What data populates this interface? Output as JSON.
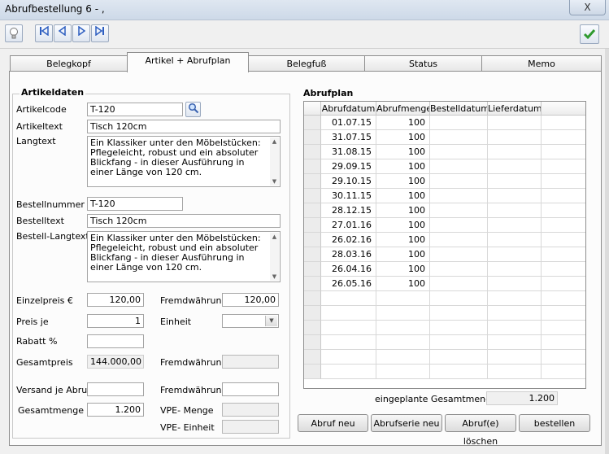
{
  "window": {
    "title": "Abrufbestellung 6 -  ,",
    "close_label": "X"
  },
  "toolbar": {
    "hint_icon": "lightbulb-icon",
    "confirm_icon": "checkmark-icon"
  },
  "tabs": [
    {
      "label": "Belegkopf",
      "active": false
    },
    {
      "label": "Artikel + Abrufplan",
      "active": true
    },
    {
      "label": "Belegfuß",
      "active": false
    },
    {
      "label": "Status",
      "active": false
    },
    {
      "label": "Memo",
      "active": false
    }
  ],
  "artikel": {
    "section_title": "Artikeldaten",
    "artikelcode_label": "Artikelcode",
    "artikelcode": "T-120",
    "artikeltext_label": "Artikeltext",
    "artikeltext": "Tisch 120cm",
    "langtext_label": "Langtext",
    "langtext": "Ein Klassiker unter den Möbelstücken: Pflegeleicht, robust und ein absoluter Blickfang - in dieser Ausführung in einer Länge von 120 cm.",
    "bestellnummer_label": "Bestellnummer",
    "bestellnummer": "T-120",
    "bestelltext_label": "Bestelltext",
    "bestelltext": "Tisch 120cm",
    "bestell_langtext_label": "Bestell-Langtext",
    "bestell_langtext": "Ein Klassiker unter den Möbelstücken: Pflegeleicht, robust und ein absoluter Blickfang - in dieser Ausführung in einer Länge von 120 cm.",
    "einzelpreis_label": "Einzelpreis €",
    "einzelpreis": "120,00",
    "fremdwaehrung1_label": "Fremdwährung",
    "fremdwaehrung1": "120,00",
    "preis_je_label": "Preis je",
    "preis_je": "1",
    "einheit_label": "Einheit",
    "einheit": "",
    "rabatt_label": "Rabatt %",
    "rabatt": "",
    "gesamtpreis_label": "Gesamtpreis",
    "gesamtpreis": "144.000,00",
    "fremdwaehrung2_label": "Fremdwährung",
    "fremdwaehrung2": "",
    "versand_label": "Versand je Abruf",
    "versand": "",
    "fremdwaehrung3_label": "Fremdwährung",
    "fremdwaehrung3": "",
    "gesamtmenge_label": "Gesamtmenge",
    "gesamtmenge": "1.200",
    "vpe_menge_label": "VPE- Menge",
    "vpe_menge": "",
    "vpe_einheit_label": "VPE- Einheit",
    "vpe_einheit": ""
  },
  "abrufplan": {
    "section_title": "Abrufplan",
    "columns": [
      "Abrufdatum",
      "Abrufmenge",
      "Bestelldatum",
      "Lieferdatum"
    ],
    "rows": [
      [
        "01.07.15",
        "100",
        "",
        ""
      ],
      [
        "31.07.15",
        "100",
        "",
        ""
      ],
      [
        "31.08.15",
        "100",
        "",
        ""
      ],
      [
        "29.09.15",
        "100",
        "",
        ""
      ],
      [
        "29.10.15",
        "100",
        "",
        ""
      ],
      [
        "30.11.15",
        "100",
        "",
        ""
      ],
      [
        "28.12.15",
        "100",
        "",
        ""
      ],
      [
        "27.01.16",
        "100",
        "",
        ""
      ],
      [
        "26.02.16",
        "100",
        "",
        ""
      ],
      [
        "28.03.16",
        "100",
        "",
        ""
      ],
      [
        "26.04.16",
        "100",
        "",
        ""
      ],
      [
        "26.05.16",
        "100",
        "",
        ""
      ]
    ],
    "total_label": "eingeplante Gesamtmenge",
    "total": "1.200",
    "buttons": {
      "abruf_neu": "Abruf neu",
      "abrufserie_neu": "Abrufserie neu",
      "abruf_loeschen": "Abruf(e) löschen",
      "bestellen": "bestellen"
    }
  }
}
